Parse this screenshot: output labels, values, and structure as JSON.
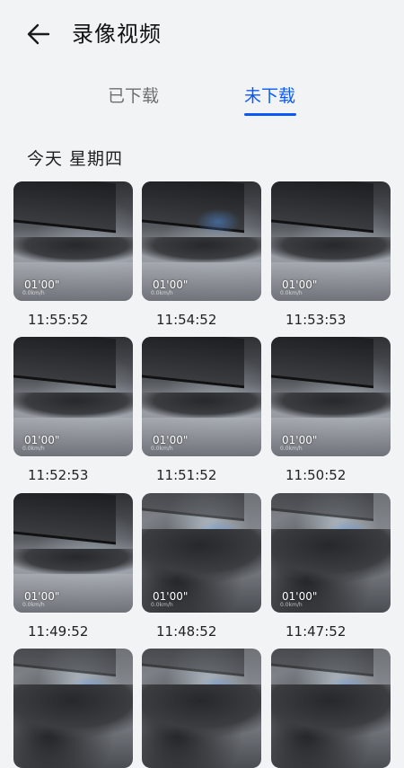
{
  "header": {
    "title": "录像视频",
    "back_icon": "arrow-left-icon"
  },
  "tabs": [
    {
      "label": "已下载",
      "active": false
    },
    {
      "label": "未下载",
      "active": true
    }
  ],
  "accent_color": "#0a59f7",
  "section": {
    "title": "今天 星期四"
  },
  "videos": [
    {
      "duration": "01'00\"",
      "speed": "0.0km/h",
      "time": "11:55:52"
    },
    {
      "duration": "01'00\"",
      "speed": "0.0km/h",
      "time": "11:54:52"
    },
    {
      "duration": "01'00\"",
      "speed": "0.0km/h",
      "time": "11:53:53"
    },
    {
      "duration": "01'00\"",
      "speed": "0.0km/h",
      "time": "11:52:53"
    },
    {
      "duration": "01'00\"",
      "speed": "0.0km/h",
      "time": "11:51:52"
    },
    {
      "duration": "01'00\"",
      "speed": "0.0km/h",
      "time": "11:50:52"
    },
    {
      "duration": "01'00\"",
      "speed": "0.0km/h",
      "time": "11:49:52"
    },
    {
      "duration": "01'00\"",
      "speed": "0.0km/h",
      "time": "11:48:52"
    },
    {
      "duration": "01'00\"",
      "speed": "0.0km/h",
      "time": "11:47:52"
    },
    {
      "duration": "",
      "speed": "",
      "time": ""
    },
    {
      "duration": "",
      "speed": "",
      "time": ""
    },
    {
      "duration": "",
      "speed": "",
      "time": ""
    }
  ]
}
